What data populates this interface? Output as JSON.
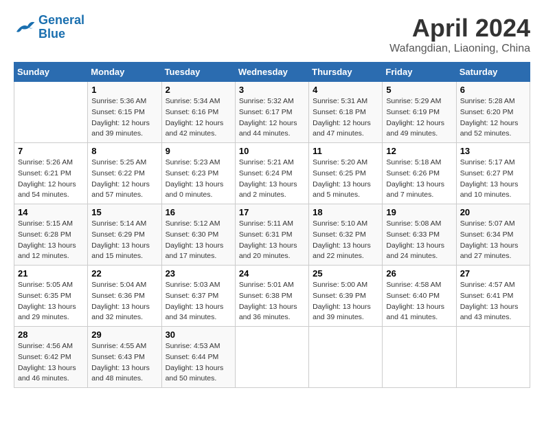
{
  "logo": {
    "line1": "General",
    "line2": "Blue"
  },
  "title": "April 2024",
  "location": "Wafangdian, Liaoning, China",
  "weekdays": [
    "Sunday",
    "Monday",
    "Tuesday",
    "Wednesday",
    "Thursday",
    "Friday",
    "Saturday"
  ],
  "weeks": [
    [
      {
        "day": "",
        "sunrise": "",
        "sunset": "",
        "daylight": ""
      },
      {
        "day": "1",
        "sunrise": "Sunrise: 5:36 AM",
        "sunset": "Sunset: 6:15 PM",
        "daylight": "Daylight: 12 hours and 39 minutes."
      },
      {
        "day": "2",
        "sunrise": "Sunrise: 5:34 AM",
        "sunset": "Sunset: 6:16 PM",
        "daylight": "Daylight: 12 hours and 42 minutes."
      },
      {
        "day": "3",
        "sunrise": "Sunrise: 5:32 AM",
        "sunset": "Sunset: 6:17 PM",
        "daylight": "Daylight: 12 hours and 44 minutes."
      },
      {
        "day": "4",
        "sunrise": "Sunrise: 5:31 AM",
        "sunset": "Sunset: 6:18 PM",
        "daylight": "Daylight: 12 hours and 47 minutes."
      },
      {
        "day": "5",
        "sunrise": "Sunrise: 5:29 AM",
        "sunset": "Sunset: 6:19 PM",
        "daylight": "Daylight: 12 hours and 49 minutes."
      },
      {
        "day": "6",
        "sunrise": "Sunrise: 5:28 AM",
        "sunset": "Sunset: 6:20 PM",
        "daylight": "Daylight: 12 hours and 52 minutes."
      }
    ],
    [
      {
        "day": "7",
        "sunrise": "Sunrise: 5:26 AM",
        "sunset": "Sunset: 6:21 PM",
        "daylight": "Daylight: 12 hours and 54 minutes."
      },
      {
        "day": "8",
        "sunrise": "Sunrise: 5:25 AM",
        "sunset": "Sunset: 6:22 PM",
        "daylight": "Daylight: 12 hours and 57 minutes."
      },
      {
        "day": "9",
        "sunrise": "Sunrise: 5:23 AM",
        "sunset": "Sunset: 6:23 PM",
        "daylight": "Daylight: 13 hours and 0 minutes."
      },
      {
        "day": "10",
        "sunrise": "Sunrise: 5:21 AM",
        "sunset": "Sunset: 6:24 PM",
        "daylight": "Daylight: 13 hours and 2 minutes."
      },
      {
        "day": "11",
        "sunrise": "Sunrise: 5:20 AM",
        "sunset": "Sunset: 6:25 PM",
        "daylight": "Daylight: 13 hours and 5 minutes."
      },
      {
        "day": "12",
        "sunrise": "Sunrise: 5:18 AM",
        "sunset": "Sunset: 6:26 PM",
        "daylight": "Daylight: 13 hours and 7 minutes."
      },
      {
        "day": "13",
        "sunrise": "Sunrise: 5:17 AM",
        "sunset": "Sunset: 6:27 PM",
        "daylight": "Daylight: 13 hours and 10 minutes."
      }
    ],
    [
      {
        "day": "14",
        "sunrise": "Sunrise: 5:15 AM",
        "sunset": "Sunset: 6:28 PM",
        "daylight": "Daylight: 13 hours and 12 minutes."
      },
      {
        "day": "15",
        "sunrise": "Sunrise: 5:14 AM",
        "sunset": "Sunset: 6:29 PM",
        "daylight": "Daylight: 13 hours and 15 minutes."
      },
      {
        "day": "16",
        "sunrise": "Sunrise: 5:12 AM",
        "sunset": "Sunset: 6:30 PM",
        "daylight": "Daylight: 13 hours and 17 minutes."
      },
      {
        "day": "17",
        "sunrise": "Sunrise: 5:11 AM",
        "sunset": "Sunset: 6:31 PM",
        "daylight": "Daylight: 13 hours and 20 minutes."
      },
      {
        "day": "18",
        "sunrise": "Sunrise: 5:10 AM",
        "sunset": "Sunset: 6:32 PM",
        "daylight": "Daylight: 13 hours and 22 minutes."
      },
      {
        "day": "19",
        "sunrise": "Sunrise: 5:08 AM",
        "sunset": "Sunset: 6:33 PM",
        "daylight": "Daylight: 13 hours and 24 minutes."
      },
      {
        "day": "20",
        "sunrise": "Sunrise: 5:07 AM",
        "sunset": "Sunset: 6:34 PM",
        "daylight": "Daylight: 13 hours and 27 minutes."
      }
    ],
    [
      {
        "day": "21",
        "sunrise": "Sunrise: 5:05 AM",
        "sunset": "Sunset: 6:35 PM",
        "daylight": "Daylight: 13 hours and 29 minutes."
      },
      {
        "day": "22",
        "sunrise": "Sunrise: 5:04 AM",
        "sunset": "Sunset: 6:36 PM",
        "daylight": "Daylight: 13 hours and 32 minutes."
      },
      {
        "day": "23",
        "sunrise": "Sunrise: 5:03 AM",
        "sunset": "Sunset: 6:37 PM",
        "daylight": "Daylight: 13 hours and 34 minutes."
      },
      {
        "day": "24",
        "sunrise": "Sunrise: 5:01 AM",
        "sunset": "Sunset: 6:38 PM",
        "daylight": "Daylight: 13 hours and 36 minutes."
      },
      {
        "day": "25",
        "sunrise": "Sunrise: 5:00 AM",
        "sunset": "Sunset: 6:39 PM",
        "daylight": "Daylight: 13 hours and 39 minutes."
      },
      {
        "day": "26",
        "sunrise": "Sunrise: 4:58 AM",
        "sunset": "Sunset: 6:40 PM",
        "daylight": "Daylight: 13 hours and 41 minutes."
      },
      {
        "day": "27",
        "sunrise": "Sunrise: 4:57 AM",
        "sunset": "Sunset: 6:41 PM",
        "daylight": "Daylight: 13 hours and 43 minutes."
      }
    ],
    [
      {
        "day": "28",
        "sunrise": "Sunrise: 4:56 AM",
        "sunset": "Sunset: 6:42 PM",
        "daylight": "Daylight: 13 hours and 46 minutes."
      },
      {
        "day": "29",
        "sunrise": "Sunrise: 4:55 AM",
        "sunset": "Sunset: 6:43 PM",
        "daylight": "Daylight: 13 hours and 48 minutes."
      },
      {
        "day": "30",
        "sunrise": "Sunrise: 4:53 AM",
        "sunset": "Sunset: 6:44 PM",
        "daylight": "Daylight: 13 hours and 50 minutes."
      },
      {
        "day": "",
        "sunrise": "",
        "sunset": "",
        "daylight": ""
      },
      {
        "day": "",
        "sunrise": "",
        "sunset": "",
        "daylight": ""
      },
      {
        "day": "",
        "sunrise": "",
        "sunset": "",
        "daylight": ""
      },
      {
        "day": "",
        "sunrise": "",
        "sunset": "",
        "daylight": ""
      }
    ]
  ]
}
